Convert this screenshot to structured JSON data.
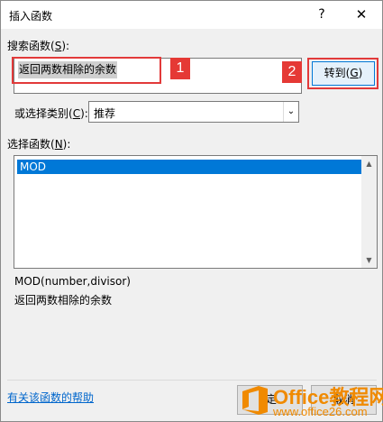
{
  "dialog": {
    "title": "插入函数",
    "help_glyph": "?",
    "close_glyph": "✕"
  },
  "search": {
    "label": "搜索函数(",
    "label_key": "S",
    "label_end": "):",
    "value": "返回两数相除的余数",
    "go_label": "转到(",
    "go_key": "G",
    "go_end": ")"
  },
  "callouts": {
    "one": "1",
    "two": "2"
  },
  "category": {
    "label": "或选择类别(",
    "label_key": "C",
    "label_end": "):",
    "selected": "推荐"
  },
  "functions": {
    "label": "选择函数(",
    "label_key": "N",
    "label_end": "):",
    "items": [
      "MOD"
    ],
    "signature": "MOD(number,divisor)",
    "description": "返回两数相除的余数"
  },
  "footer": {
    "help_link": "有关该函数的帮助",
    "ok_label": "定",
    "cancel_label": "取消"
  },
  "watermark": {
    "title_a": "Office",
    "title_b": "教程网",
    "url": "www.office26.com"
  },
  "colors": {
    "callout_red": "#e53935",
    "selection_blue": "#0078d7",
    "link_blue": "#0066cc",
    "watermark_orange": "#f08a00"
  }
}
